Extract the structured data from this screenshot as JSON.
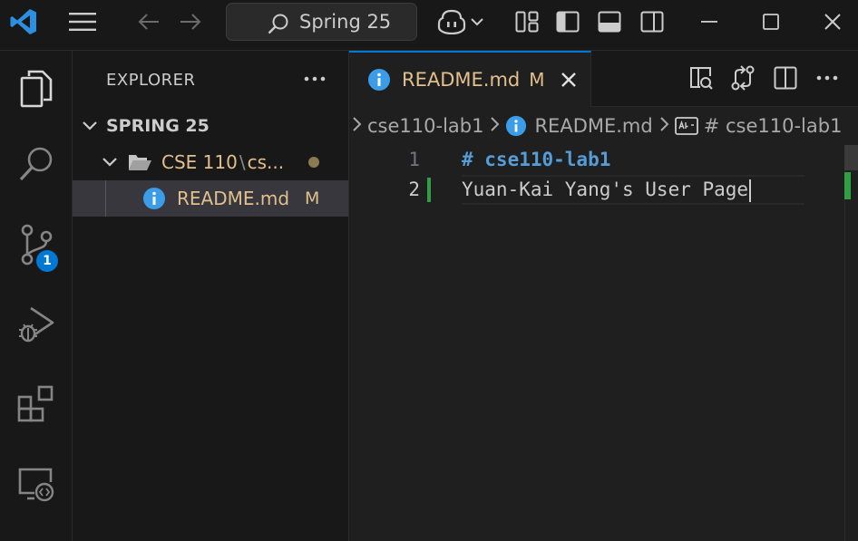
{
  "titlebar": {
    "search_text": "Spring 25",
    "icons": [
      "vscode-logo-icon",
      "menu-icon",
      "back-arrow-icon",
      "forward-arrow-icon",
      "search-icon",
      "copilot-icon",
      "chevron-down-icon",
      "customize-layout-icon",
      "toggle-primary-sidebar-icon",
      "toggle-panel-icon",
      "toggle-secondary-sidebar-icon",
      "minimize-icon",
      "maximize-icon",
      "close-icon"
    ]
  },
  "activitybar": {
    "items": [
      "explorer-icon",
      "search-icon",
      "source-control-icon",
      "run-debug-icon",
      "extensions-icon",
      "remote-explorer-icon"
    ],
    "source_control_badge": "1"
  },
  "sidebar": {
    "title": "EXPLORER",
    "root_label": "SPRING 25",
    "folder_label": "CSE 110",
    "folder_sep": "\\",
    "folder_tail": "cs...",
    "file_label": "README.md",
    "file_status": "M"
  },
  "editor": {
    "tab_label": "README.md",
    "tab_status": "M",
    "breadcrumb": {
      "folder": "cse110-lab1",
      "file": "README.md",
      "symbol": "# cse110-lab1"
    },
    "lines": [
      {
        "number": "1",
        "text": "# cse110-lab1"
      },
      {
        "number": "2",
        "text": "Yuan-Kai Yang's User Page"
      }
    ]
  },
  "colors": {
    "accent": "#0078d4",
    "modified": "#e2c08d",
    "added": "#2ea043",
    "heading": "#569cd6"
  }
}
